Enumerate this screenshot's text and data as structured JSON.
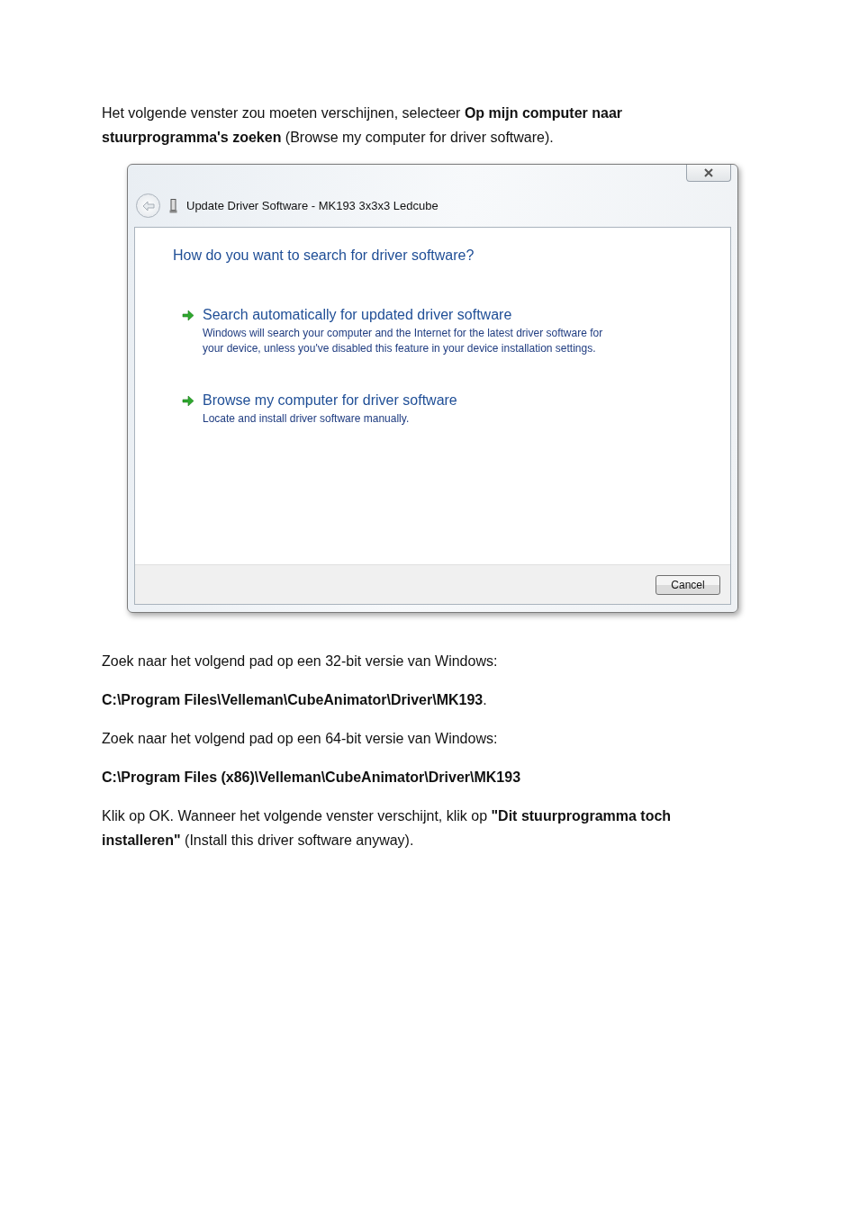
{
  "intro": "Het volgende venster zou moeten verschijnen, selecteer **Op mijn computer naar stuurprogramma's zoeken** (Browse my computer for driver software).",
  "dialog": {
    "title": "Update Driver Software - MK193 3x3x3 Ledcube",
    "heading": "How do you want to search for driver software?",
    "options": [
      {
        "title": "Search automatically for updated driver software",
        "description": "Windows will search your computer and the Internet for the latest driver software for your device, unless you've disabled this feature in your device installation settings."
      },
      {
        "title": "Browse my computer for driver software",
        "description": "Locate and install driver software manually."
      }
    ],
    "buttons": [
      "Cancel"
    ]
  },
  "paragraphs": [
    {
      "kind": "text",
      "text": "Zoek naar het volgend pad op een 32-bit versie van Windows:"
    },
    {
      "kind": "text",
      "text": "**C:\\Program Files\\Velleman\\CubeAnimator\\Driver\\MK193**."
    },
    {
      "kind": "text",
      "text": "Zoek naar het volgend pad op een 64-bit versie van Windows:"
    },
    {
      "kind": "path",
      "text": "C:\\Program Files (x86)\\Velleman\\CubeAnimator\\Driver\\MK193"
    },
    {
      "kind": "text",
      "text": "Klik op OK. Wanneer het volgende venster verschijnt, klik op **\"Dit stuurprogramma toch installeren\"** (Install this driver software anyway)."
    }
  ]
}
